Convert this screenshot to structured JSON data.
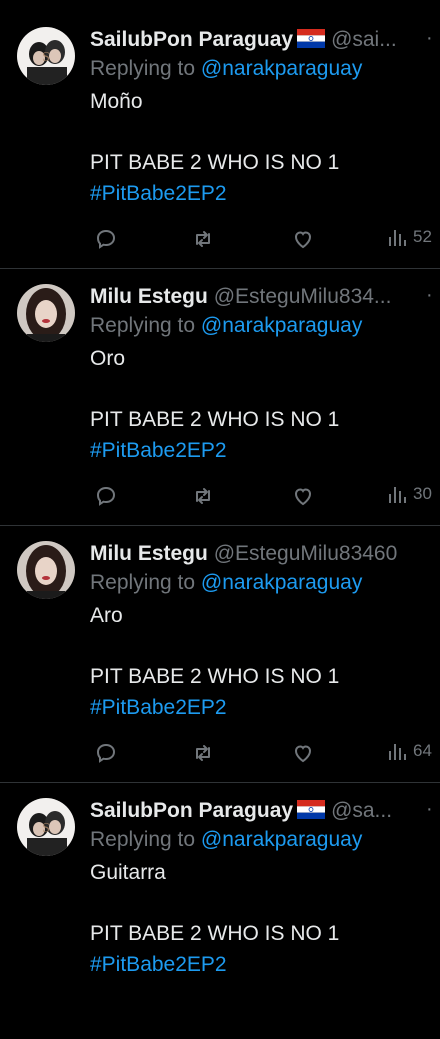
{
  "tweets": [
    {
      "name": "SailubPon Paraguay",
      "flag": true,
      "handle": "@sai...",
      "more": "·",
      "replying_prefix": "Replying to ",
      "replying_handle": "@narakparaguay",
      "word": "Moño",
      "line": "PIT BABE 2 WHO IS NO 1",
      "hashtag": "#PitBabe2EP2",
      "views": "52",
      "avatar": "sailubpon"
    },
    {
      "name": "Milu Estegu",
      "flag": false,
      "handle": "@EsteguMilu834...",
      "more": "·",
      "replying_prefix": "Replying to ",
      "replying_handle": "@narakparaguay",
      "word": "Oro",
      "line": "PIT BABE 2 WHO IS NO 1",
      "hashtag": "#PitBabe2EP2",
      "views": "30",
      "avatar": "milu"
    },
    {
      "name": "Milu Estegu",
      "flag": false,
      "handle": "@EsteguMilu83460",
      "more": "",
      "replying_prefix": "Replying to ",
      "replying_handle": "@narakparaguay",
      "word": "Aro",
      "line": "PIT BABE 2 WHO IS NO 1",
      "hashtag": "#PitBabe2EP2",
      "views": "64",
      "avatar": "milu"
    },
    {
      "name": "SailubPon Paraguay",
      "flag": true,
      "handle": "@sa...",
      "more": "·",
      "replying_prefix": "Replying to ",
      "replying_handle": "@narakparaguay",
      "word": "Guitarra",
      "line": "PIT BABE 2 WHO IS NO 1",
      "hashtag": "#PitBabe2EP2",
      "views": "",
      "avatar": "sailubpon"
    }
  ],
  "colors": {
    "background": "#000000",
    "text": "#e7e9ea",
    "muted": "#71767b",
    "link": "#1d9bf0",
    "divider": "#2f3336"
  }
}
